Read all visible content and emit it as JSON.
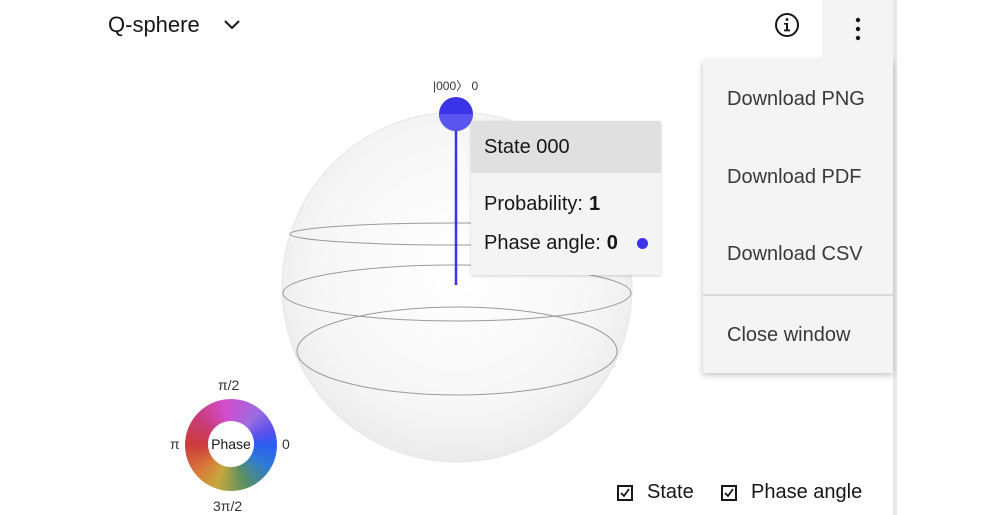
{
  "visualization_select": {
    "value": "Q-sphere"
  },
  "icons": {
    "chevron": "chevron-down-icon",
    "info": "information-icon",
    "overflow": "overflow-menu-vertical-icon",
    "checkbox": "checkbox-checked-icon"
  },
  "menu": {
    "items": [
      "Download PNG",
      "Download PDF",
      "Download CSV",
      "Close window"
    ]
  },
  "sphere": {
    "state_label": "|000〉 0",
    "state_color": "#3a33e8"
  },
  "tooltip": {
    "title": "State 000",
    "probability_label": "Probability:",
    "probability_value": "1",
    "phase_label": "Phase angle:",
    "phase_value": "0",
    "phase_color": "#3a33e8"
  },
  "phase_wheel": {
    "center_label": "Phase",
    "top_label": "π/2",
    "left_label": "π",
    "right_label": "0",
    "bottom_label": "3π/2"
  },
  "legend_toggles": {
    "state_label": "State",
    "state_checked": true,
    "phase_label": "Phase angle",
    "phase_checked": true
  }
}
